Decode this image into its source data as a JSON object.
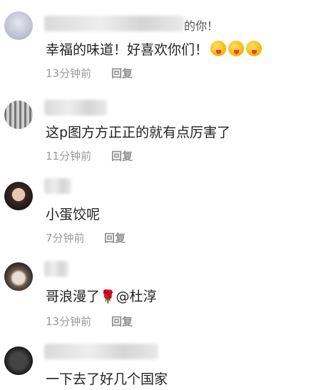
{
  "comments": [
    {
      "username_tail": "的你！",
      "text": "幸福的味道！好喜欢你们！",
      "emoji": [
        "face-tongue-icon",
        "face-tongue-icon",
        "face-tongue-icon"
      ],
      "time": "13分钟前",
      "reply": "回复"
    },
    {
      "text": "这p图方方正正的就有点厉害了",
      "time": "11分钟前",
      "reply": "回复"
    },
    {
      "text": "小蛋饺呢",
      "time": "7分钟前",
      "reply": "回复"
    },
    {
      "text_before": "哥浪漫了",
      "icon": "rose-icon",
      "text_after": "@杜淳",
      "time": "13分钟前",
      "reply": "回复"
    },
    {
      "text": "一下去了好几个国家"
    }
  ]
}
